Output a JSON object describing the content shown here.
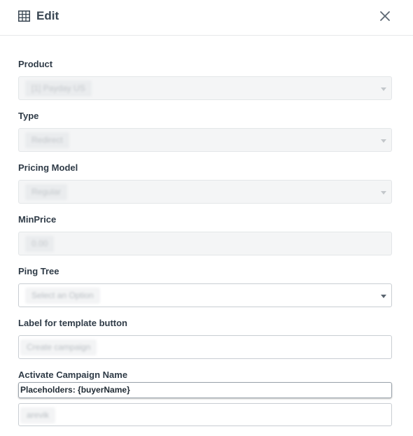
{
  "header": {
    "title": "Edit",
    "title_icon": "table-icon",
    "close_icon": "close-icon"
  },
  "fields": {
    "product": {
      "label": "Product",
      "value": "[1] Payday US"
    },
    "type": {
      "label": "Type",
      "value": "Redirect"
    },
    "pricing_model": {
      "label": "Pricing Model",
      "value": "Regular"
    },
    "min_price": {
      "label": "MinPrice",
      "value": "0.00"
    },
    "ping_tree": {
      "label": "Ping Tree",
      "value": "Select an Option"
    },
    "template_button_label": {
      "label": "Label for template button",
      "value": "Create campaign"
    },
    "activate_campaign_name": {
      "label": "Activate Campaign Name",
      "placeholders_hint": "Placeholders: {buyerName}",
      "value": "arevik"
    }
  },
  "colors": {
    "label_text": "#2f3b47",
    "disabled_bg": "#f4f5f6",
    "border": "#c8cdd2"
  }
}
